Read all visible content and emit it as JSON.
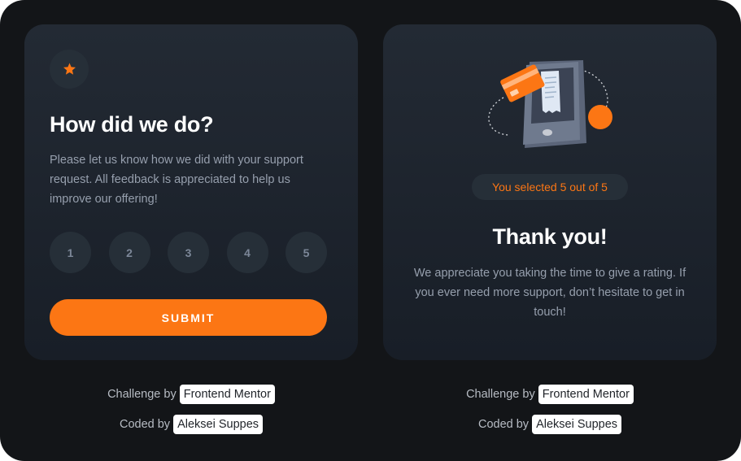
{
  "rating_card": {
    "title": "How did we do?",
    "description": "Please let us know how we did with your support request. All feedback is appreciated to help us improve our offering!",
    "ratings": [
      "1",
      "2",
      "3",
      "4",
      "5"
    ],
    "submit_label": "SUBMIT",
    "icon": "star-icon"
  },
  "thankyou_card": {
    "selected_text": "You selected 5 out of 5",
    "title": "Thank you!",
    "description": "We appreciate you taking the time to give a rating. If you ever need more support, don’t hesitate to get in touch!",
    "illustration": "phone-payment-illustration"
  },
  "attribution": {
    "challenge_prefix": "Challenge by",
    "challenge_link": "Frontend Mentor",
    "coded_prefix": "Coded by",
    "coded_link": "Aleksei Suppes"
  },
  "colors": {
    "background": "#131518",
    "card": "#232a34",
    "accent": "#fc7614",
    "muted_text": "#969fad",
    "circle": "#262f38"
  }
}
